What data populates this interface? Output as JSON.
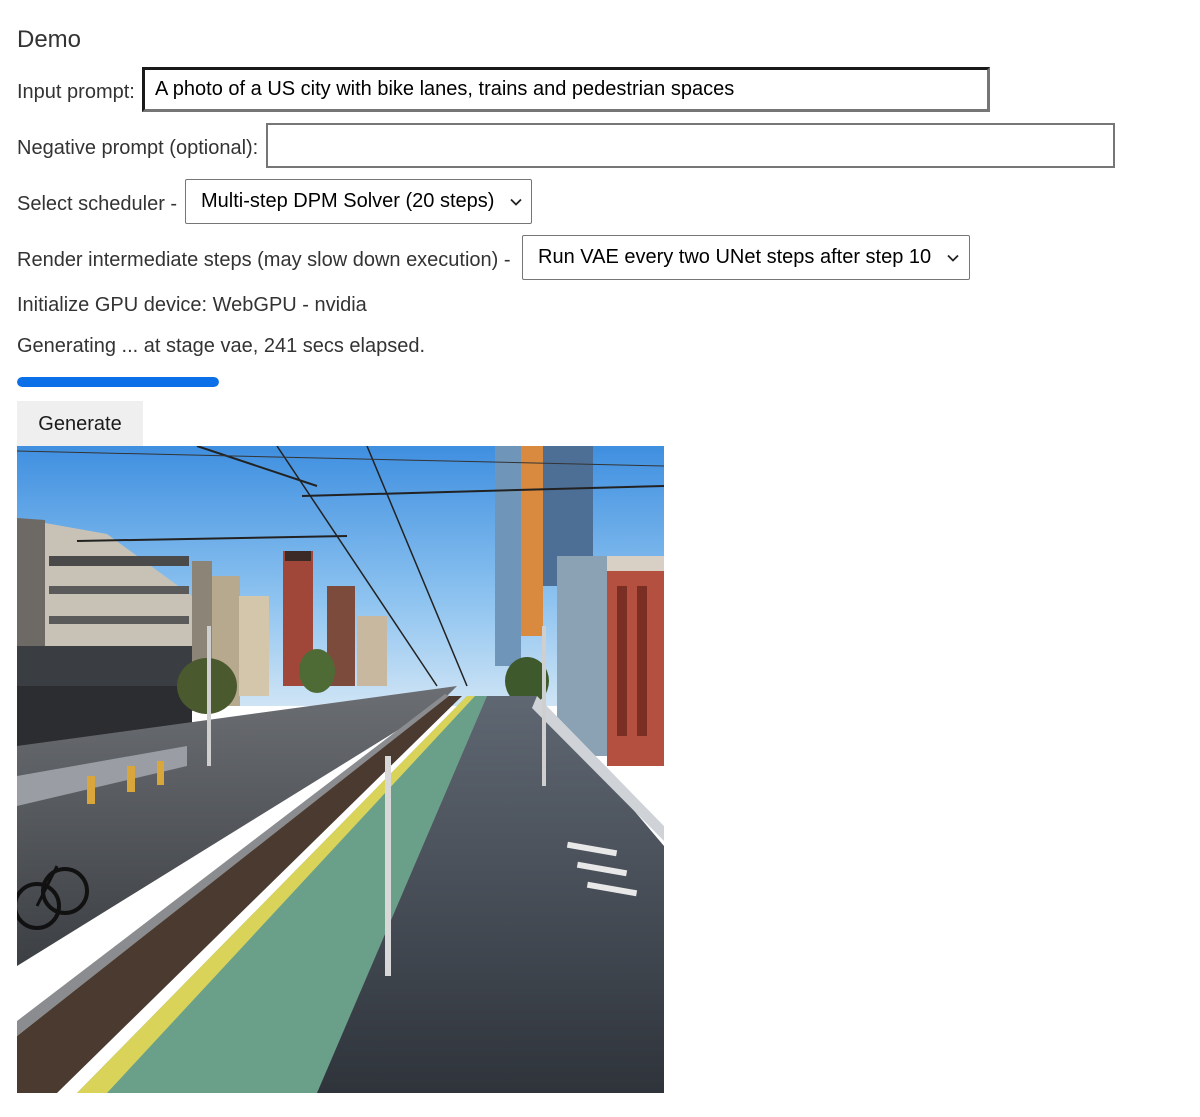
{
  "page": {
    "title": "Demo"
  },
  "form": {
    "input_prompt_label": "Input prompt:",
    "input_prompt_value": "A photo of a US city with bike lanes, trains and pedestrian spaces",
    "negative_prompt_label": "Negative prompt (optional):",
    "negative_prompt_value": "",
    "scheduler_label": "Select scheduler -",
    "scheduler_selected": "Multi-step DPM Solver (20 steps)",
    "render_steps_label": "Render intermediate steps (may slow down execution) -",
    "render_steps_selected": "Run VAE every two UNet steps after step 10"
  },
  "status": {
    "gpu": "Initialize GPU device: WebGPU - nvidia",
    "progress_text": "Generating ... at stage vae, 241 secs elapsed.",
    "progress_fraction": 1.0
  },
  "actions": {
    "generate_label": "Generate"
  },
  "output": {
    "image_subject": "generated street scene with train tracks, bike lanes and city buildings"
  },
  "icons": {
    "select_chevron": "chevron-down-icon"
  },
  "colors": {
    "progress": "#0b6fe8",
    "text": "#333333",
    "button_bg": "#efefef"
  }
}
